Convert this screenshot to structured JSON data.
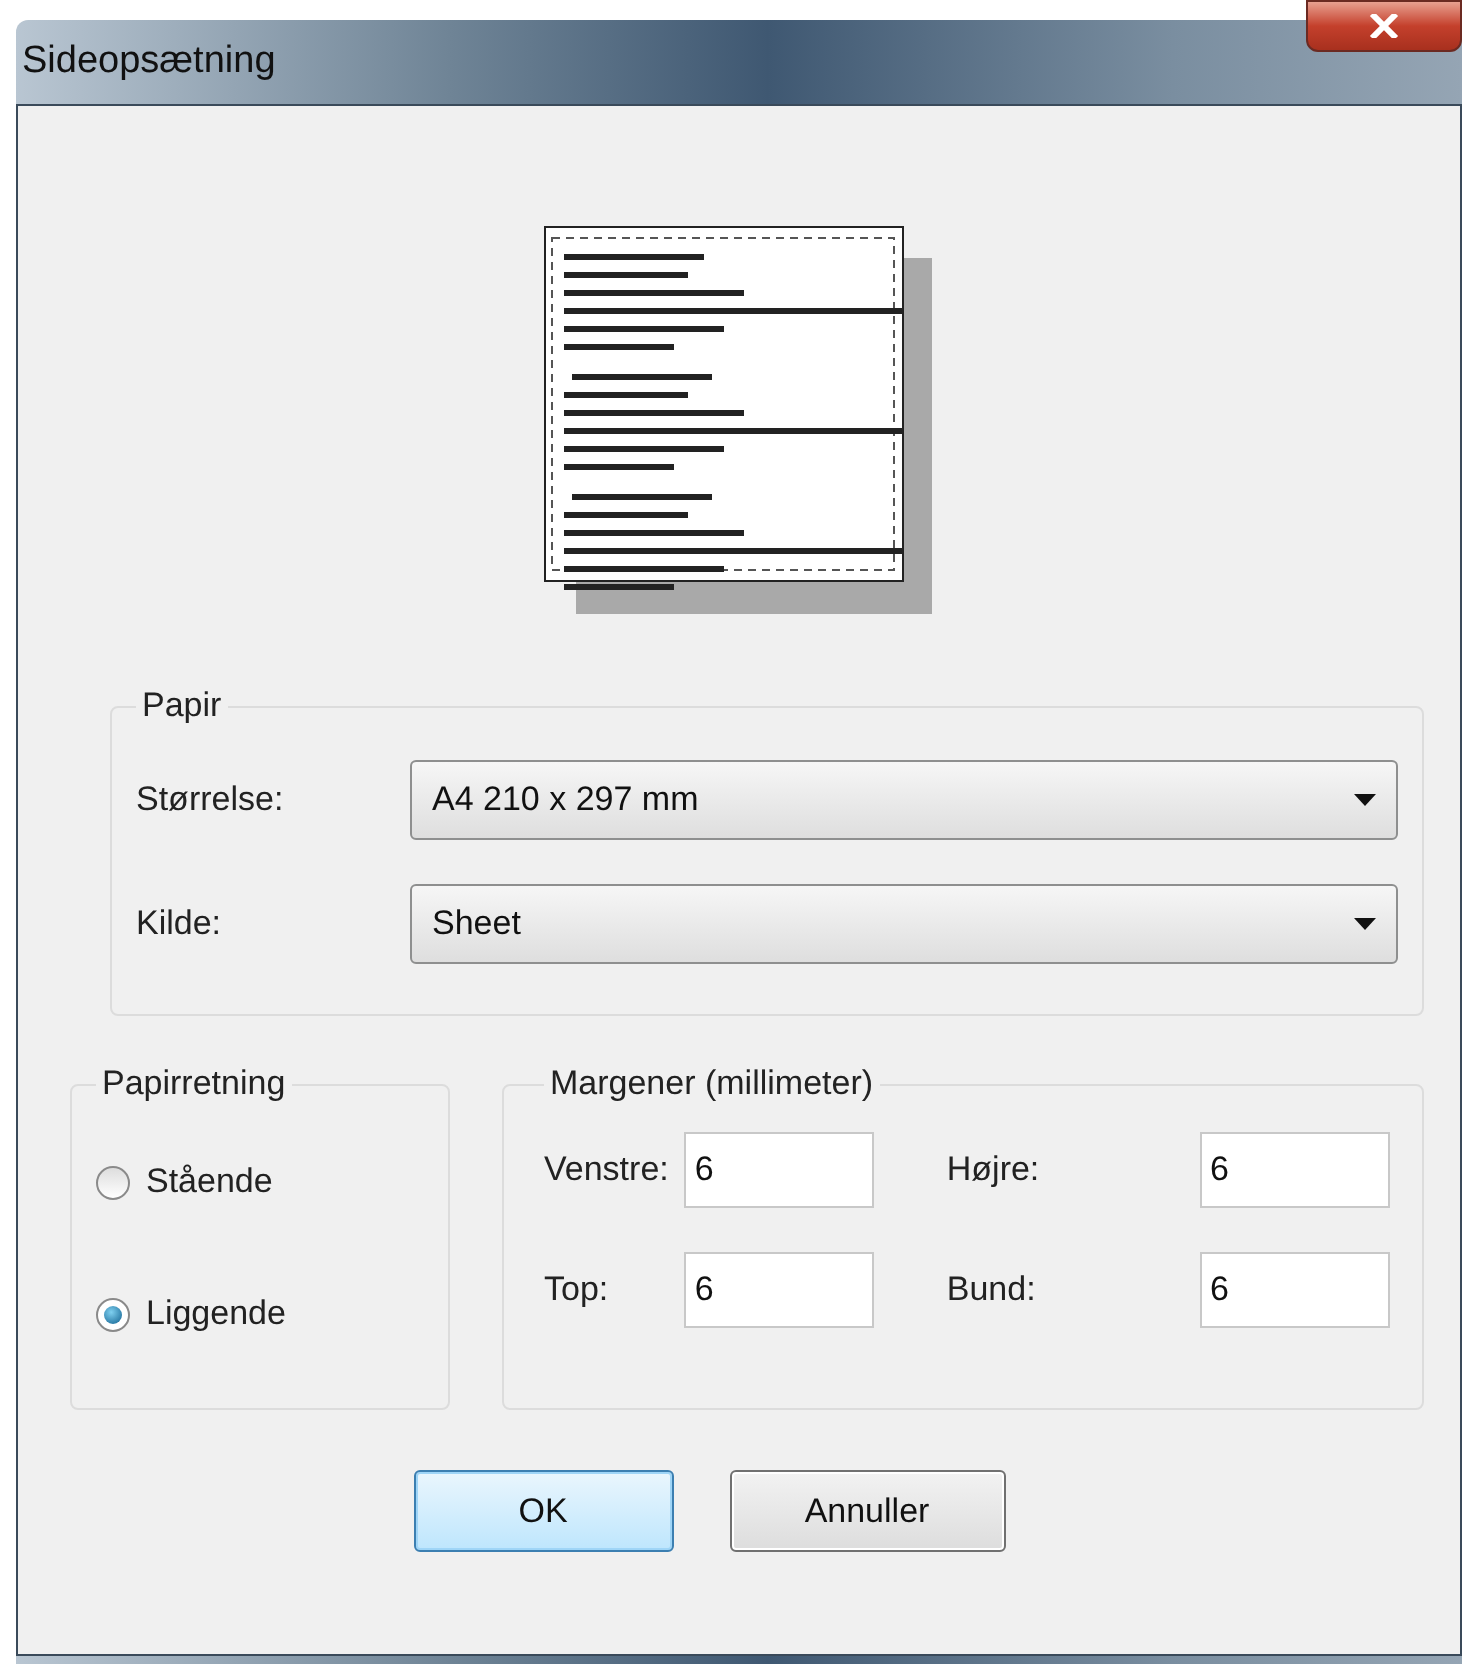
{
  "window": {
    "title": "Sideopsætning"
  },
  "paper": {
    "legend": "Papir",
    "fields": [
      {
        "label": "Størrelse:",
        "value": "A4 210 x 297 mm"
      },
      {
        "label": "Kilde:",
        "value": "Sheet"
      }
    ]
  },
  "orientation": {
    "legend": "Papirretning",
    "options": [
      {
        "label": "Stående",
        "selected": false
      },
      {
        "label": "Liggende",
        "selected": true
      }
    ]
  },
  "margins": {
    "legend": "Margener (millimeter)",
    "fields": [
      {
        "label": "Venstre:",
        "value": "6"
      },
      {
        "label": "Højre:",
        "value": "6"
      },
      {
        "label": "Top:",
        "value": "6"
      },
      {
        "label": "Bund:",
        "value": "6"
      }
    ]
  },
  "buttons": [
    {
      "label": "OK",
      "kind": "default"
    },
    {
      "label": "Annuller",
      "kind": "normal"
    }
  ]
}
